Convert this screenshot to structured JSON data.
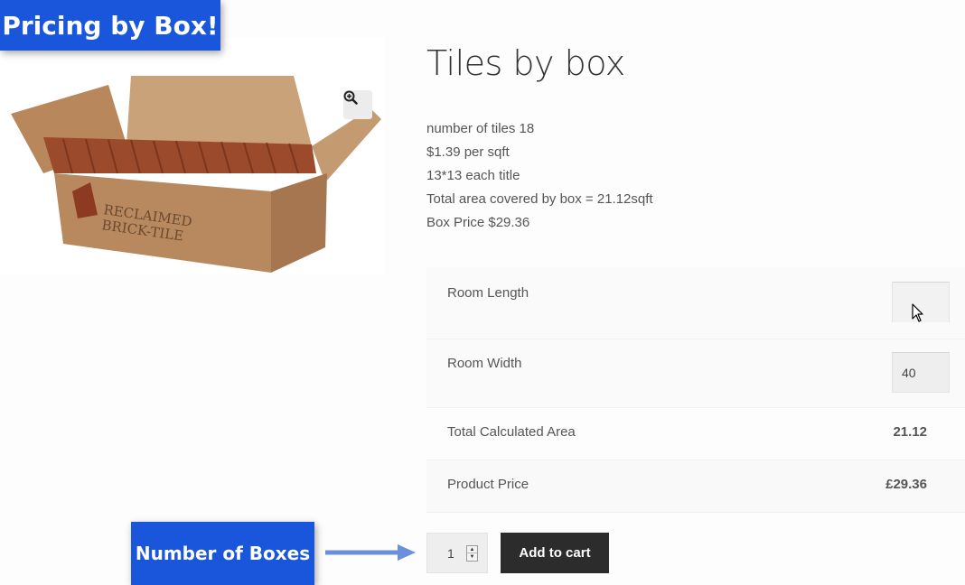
{
  "banners": {
    "top": "Pricing by Box!",
    "bottom": "Number of Boxes"
  },
  "product": {
    "title": "Tiles by box",
    "image_brand_line1": "RECLAIMED",
    "image_brand_line2": "BRICK-TILE",
    "description": [
      "number of tiles 18",
      "$1.39 per sqft",
      "13*13 each title",
      "Total area covered by box = 21.12sqft",
      "Box Price $29.36"
    ]
  },
  "calculator": {
    "room_length_label": "Room Length",
    "room_length_value": "",
    "room_width_label": "Room Width",
    "room_width_value": "40",
    "total_area_label": "Total Calculated Area",
    "total_area_value": "21.12",
    "product_price_label": "Product Price",
    "product_price_value": "£29.36"
  },
  "cart": {
    "quantity": "1",
    "add_to_cart_label": "Add to cart"
  },
  "icons": {
    "zoom": "zoom-in-icon",
    "cursor": "mouse-pointer-icon",
    "arrow": "arrow-right-icon"
  },
  "colors": {
    "banner": "#1a56db",
    "button": "#2c2c2c",
    "arrow": "#6b8fd8"
  }
}
